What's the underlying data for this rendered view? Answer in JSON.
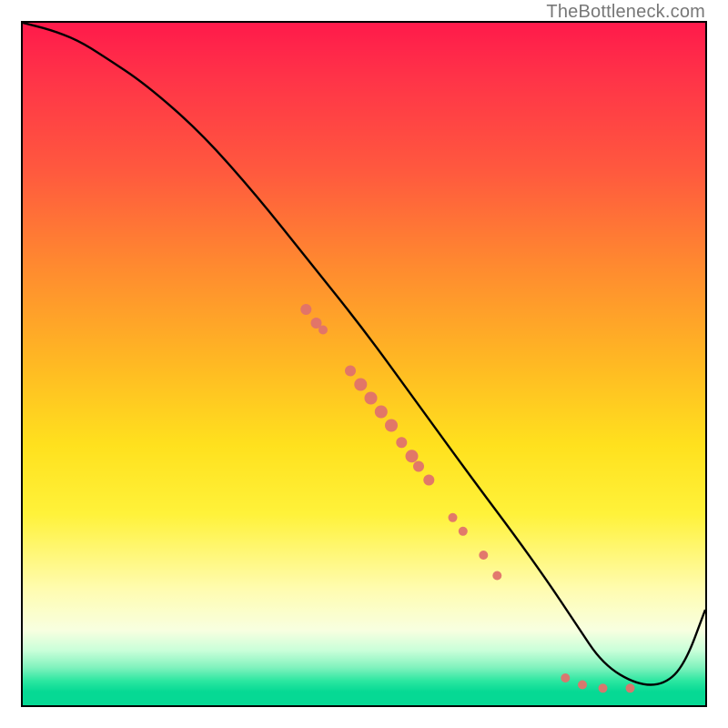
{
  "branding": "TheBottleneck.com",
  "chart_data": {
    "type": "line",
    "title": "",
    "xlabel": "",
    "ylabel": "",
    "xlim": [
      0,
      100
    ],
    "ylim": [
      0,
      100
    ],
    "curve": {
      "x": [
        0,
        4,
        8,
        12,
        18,
        26,
        34,
        42,
        50,
        58,
        66,
        72,
        77,
        81,
        85,
        90,
        94,
        97,
        100
      ],
      "y": [
        100,
        99,
        97.5,
        95,
        91,
        84,
        75,
        65,
        55,
        44,
        33,
        25,
        18,
        12,
        6,
        3,
        3,
        6,
        14
      ]
    },
    "series": [
      {
        "name": "scatter-cluster",
        "type": "scatter",
        "color": "#e0726b",
        "points": [
          {
            "x": 41.5,
            "y": 58.0,
            "r": 6
          },
          {
            "x": 43.0,
            "y": 56.0,
            "r": 6
          },
          {
            "x": 44.0,
            "y": 55.0,
            "r": 5
          },
          {
            "x": 48.0,
            "y": 49.0,
            "r": 6
          },
          {
            "x": 49.5,
            "y": 47.0,
            "r": 7
          },
          {
            "x": 51.0,
            "y": 45.0,
            "r": 7
          },
          {
            "x": 52.5,
            "y": 43.0,
            "r": 7
          },
          {
            "x": 54.0,
            "y": 41.0,
            "r": 7
          },
          {
            "x": 55.5,
            "y": 38.5,
            "r": 6
          },
          {
            "x": 57.0,
            "y": 36.5,
            "r": 7
          },
          {
            "x": 58.0,
            "y": 35.0,
            "r": 6
          },
          {
            "x": 59.5,
            "y": 33.0,
            "r": 6
          },
          {
            "x": 63.0,
            "y": 27.5,
            "r": 5
          },
          {
            "x": 64.5,
            "y": 25.5,
            "r": 5
          },
          {
            "x": 67.5,
            "y": 22.0,
            "r": 5
          },
          {
            "x": 69.5,
            "y": 19.0,
            "r": 5
          },
          {
            "x": 79.5,
            "y": 4.0,
            "r": 5
          },
          {
            "x": 82.0,
            "y": 3.0,
            "r": 5
          },
          {
            "x": 85.0,
            "y": 2.5,
            "r": 5
          },
          {
            "x": 89.0,
            "y": 2.5,
            "r": 5
          }
        ]
      }
    ],
    "gradient_stops_percent": [
      0,
      8,
      22,
      36,
      50,
      62,
      72,
      83,
      89,
      92,
      94.5,
      96.5,
      98,
      100
    ],
    "gradient_colors": [
      "#ff1a4b",
      "#ff3348",
      "#ff5a3e",
      "#ff8b2f",
      "#ffb923",
      "#ffe11e",
      "#fff23a",
      "#fffcb0",
      "#f8ffe0",
      "#c9ffd9",
      "#7ff2bd",
      "#29e6a0",
      "#06d994",
      "#06d994"
    ]
  }
}
